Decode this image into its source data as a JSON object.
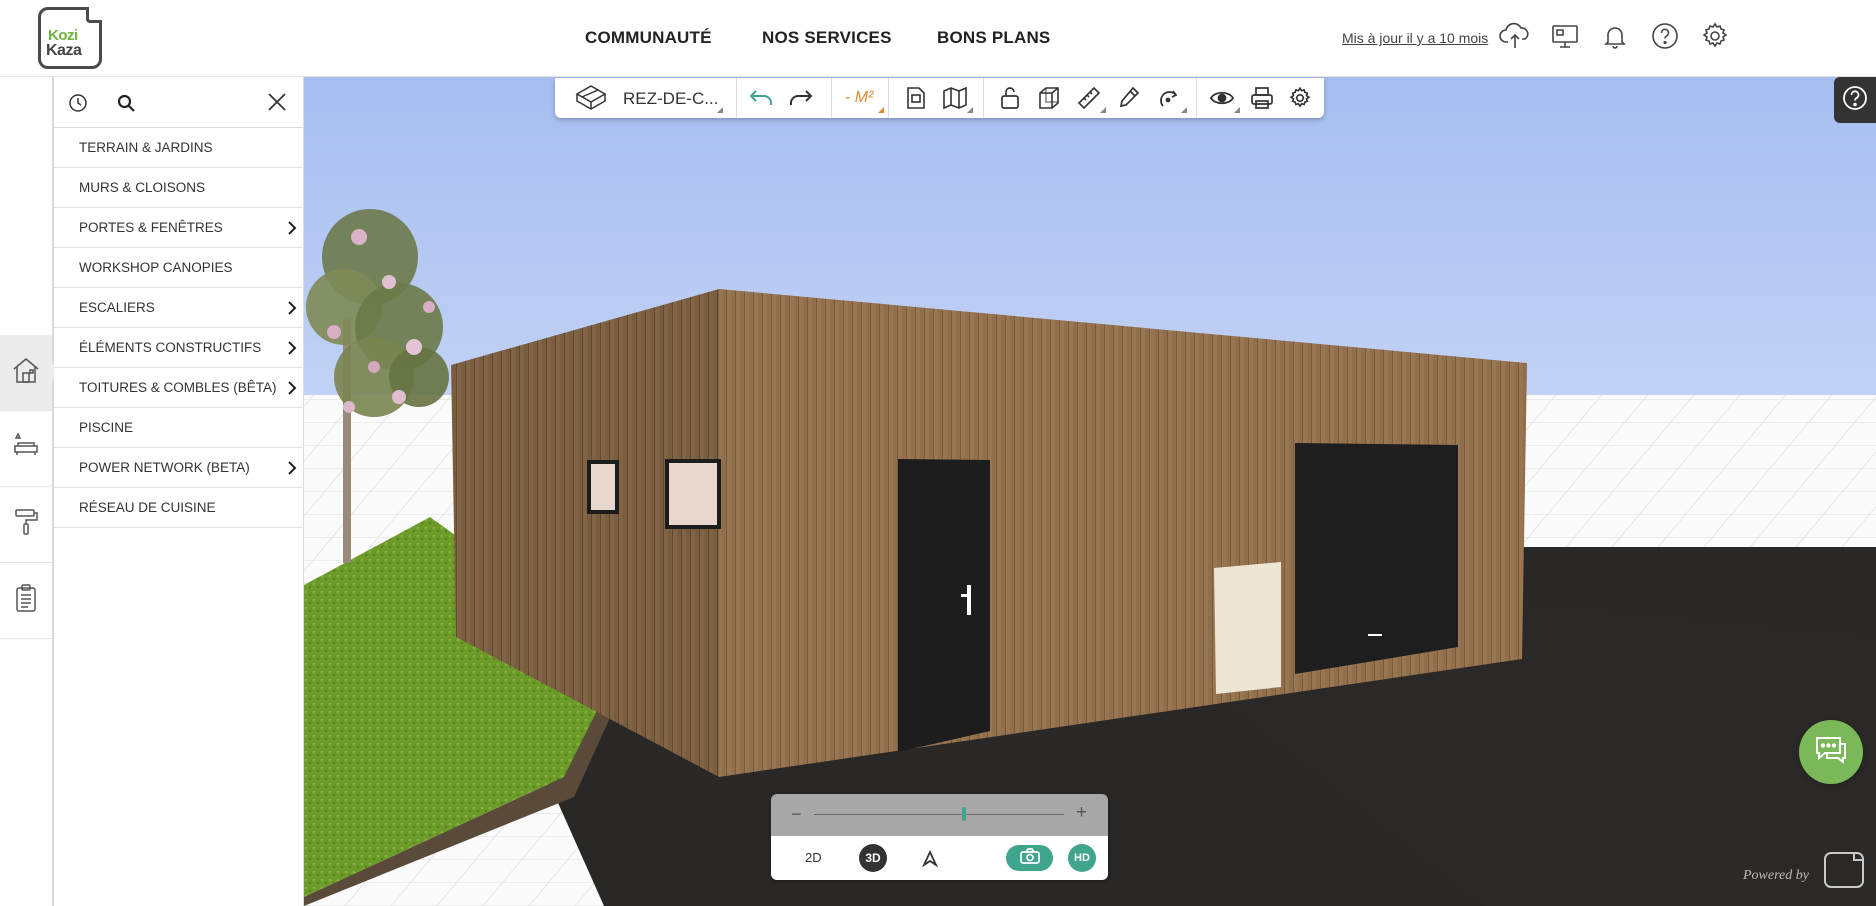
{
  "header": {
    "logo": {
      "line1": "Kozi",
      "line2": "Kaza"
    },
    "nav": [
      {
        "label": "COMMUNAUTÉ"
      },
      {
        "label": "NOS SERVICES"
      },
      {
        "label": "BONS PLANS"
      }
    ],
    "updated_label": "Mis à jour il y a 10 mois",
    "icons": [
      "cloud-upload-icon",
      "monitor-icon",
      "bell-icon",
      "help-icon",
      "settings-icon"
    ]
  },
  "rail": {
    "items": [
      "house-icon",
      "sofa-icon",
      "paint-roller-icon",
      "clipboard-icon"
    ],
    "active": 0
  },
  "catalog": {
    "items": [
      {
        "label": "TERRAIN & JARDINS",
        "has_sub": false
      },
      {
        "label": "MURS & CLOISONS",
        "has_sub": false
      },
      {
        "label": "PORTES & FENÊTRES",
        "has_sub": true
      },
      {
        "label": "WORKSHOP CANOPIES",
        "has_sub": false
      },
      {
        "label": "ESCALIERS",
        "has_sub": true
      },
      {
        "label": "ÉLÉMENTS CONSTRUCTIFS",
        "has_sub": true
      },
      {
        "label": "TOITURES & COMBLES (BÊTA)",
        "has_sub": true
      },
      {
        "label": "PISCINE",
        "has_sub": false
      },
      {
        "label": "POWER NETWORK (BETA)",
        "has_sub": true
      },
      {
        "label": "RÉSEAU DE CUISINE",
        "has_sub": false
      }
    ]
  },
  "toolbar": {
    "level_label": "REZ-DE-C...",
    "surface_label": "- M²"
  },
  "zoom": {
    "minus": "−",
    "plus": "+",
    "level": 0.6,
    "mode_2d": "2D",
    "mode_3d": "3D",
    "hd": "HD"
  },
  "footer": {
    "powered_by": "Powered by"
  },
  "colors": {
    "accent": "#3fa58c",
    "brand_green": "#6cb33f",
    "surface_orange": "#e98a2f",
    "chat_green": "#7bb85a"
  }
}
